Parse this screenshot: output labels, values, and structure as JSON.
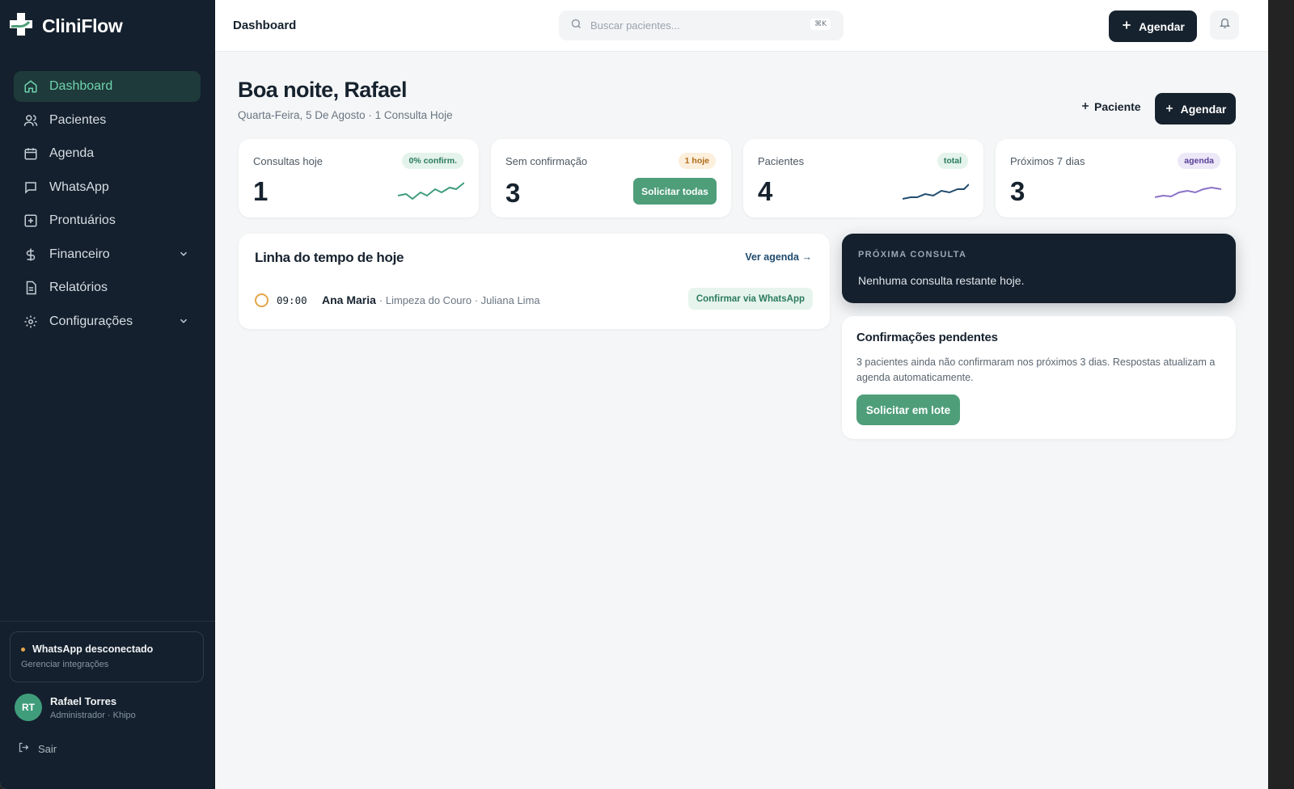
{
  "app": {
    "name": "CliniFlow"
  },
  "sidebar": {
    "items": [
      {
        "label": "Dashboard",
        "icon": "home-icon",
        "active": true
      },
      {
        "label": "Pacientes",
        "icon": "users-icon"
      },
      {
        "label": "Agenda",
        "icon": "calendar-icon"
      },
      {
        "label": "WhatsApp",
        "icon": "chat-icon"
      },
      {
        "label": "Prontuários",
        "icon": "plus-square-icon"
      },
      {
        "label": "Financeiro",
        "icon": "dollar-icon",
        "expandable": true
      },
      {
        "label": "Relatórios",
        "icon": "document-icon"
      },
      {
        "label": "Configurações",
        "icon": "gear-icon",
        "expandable": true
      }
    ],
    "whatsapp_status": {
      "title": "WhatsApp desconectado",
      "subtitle": "Gerenciar integrações",
      "status_color": "#e3a64a"
    },
    "user": {
      "initials": "RT",
      "name": "Rafael Torres",
      "role": "Administrador · Khipo"
    },
    "logout_label": "Sair"
  },
  "topbar": {
    "title": "Dashboard",
    "search_placeholder": "Buscar pacientes...",
    "search_shortcut": "⌘K",
    "agendar_label": "Agendar"
  },
  "header": {
    "greeting": "Boa noite, Rafael",
    "subtitle": "Quarta-Feira, 5 De Agosto · 1 Consulta Hoje",
    "paciente_label": "Paciente",
    "agendar_label": "Agendar"
  },
  "stats": [
    {
      "label": "Consultas hoje",
      "value": "1",
      "badge": "0% confirm.",
      "spark_color": "#3f9d7c"
    },
    {
      "label": "Sem confirmação",
      "value": "3",
      "badge": "1 hoje",
      "action": "Solicitar todas"
    },
    {
      "label": "Pacientes",
      "value": "4",
      "badge": "total",
      "spark_color": "#1f4b6e"
    },
    {
      "label": "Próximos 7 dias",
      "value": "3",
      "badge": "agenda",
      "spark_color": "#8a72c9"
    }
  ],
  "timeline": {
    "title": "Linha do tempo de hoje",
    "link": "Ver agenda →",
    "rows": [
      {
        "time": "09:00",
        "patient": "Ana Maria",
        "meta": "· Limpeza do Couro · Juliana Lima",
        "action": "Confirmar via WhatsApp"
      }
    ]
  },
  "next_appointment": {
    "label": "PRÓXIMA CONSULTA",
    "text": "Nenhuma consulta restante hoje."
  },
  "pending": {
    "title": "Confirmações pendentes",
    "text": "3 pacientes ainda não confirmaram nos próximos 3 dias. Respostas atualizam a agenda automaticamente.",
    "button": "Solicitar em lote"
  },
  "colors": {
    "sidebar_bg": "#14202d",
    "accent_green": "#4e9e7a",
    "dark_button": "#16222e"
  }
}
